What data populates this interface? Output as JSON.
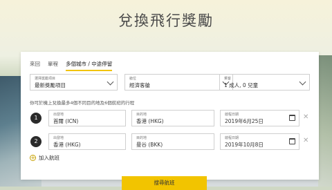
{
  "page": {
    "title": "兌換飛行獎勵"
  },
  "tabs": [
    {
      "label": "來回"
    },
    {
      "label": "單程"
    },
    {
      "label": "多個城市 / 中途停留"
    }
  ],
  "selects": {
    "reward": {
      "label": "選擇獎勵項目",
      "value": "最新獎勵項目"
    },
    "cabin": {
      "label": "艙位",
      "value": "經濟客艙"
    },
    "passengers": {
      "label": "乘客",
      "value": "1 成人, 0 兒童"
    }
  },
  "note": "你可於機上兌換最多4個不同目的地及6個航班的行程",
  "segments": [
    {
      "num": "1",
      "origin_label": "出發地",
      "origin": "首爾 (ICN)",
      "dest_label": "目的地",
      "dest": "香港 (HKG)",
      "date_label": "啟程日期",
      "date": "2019年6月25日"
    },
    {
      "num": "2",
      "origin_label": "出發地",
      "origin": "香港 (HKG)",
      "dest_label": "目的地",
      "dest": "曼谷 (BKK)",
      "date_label": "啟程日期",
      "date": "2019年10月8日"
    }
  ],
  "add_flight": "加入航班",
  "search_button": "搜尋航班",
  "colors": {
    "accent": "#f2c400"
  },
  "icons": {
    "calendar": "calendar-icon",
    "remove": "close-icon",
    "add": "plus-icon"
  }
}
